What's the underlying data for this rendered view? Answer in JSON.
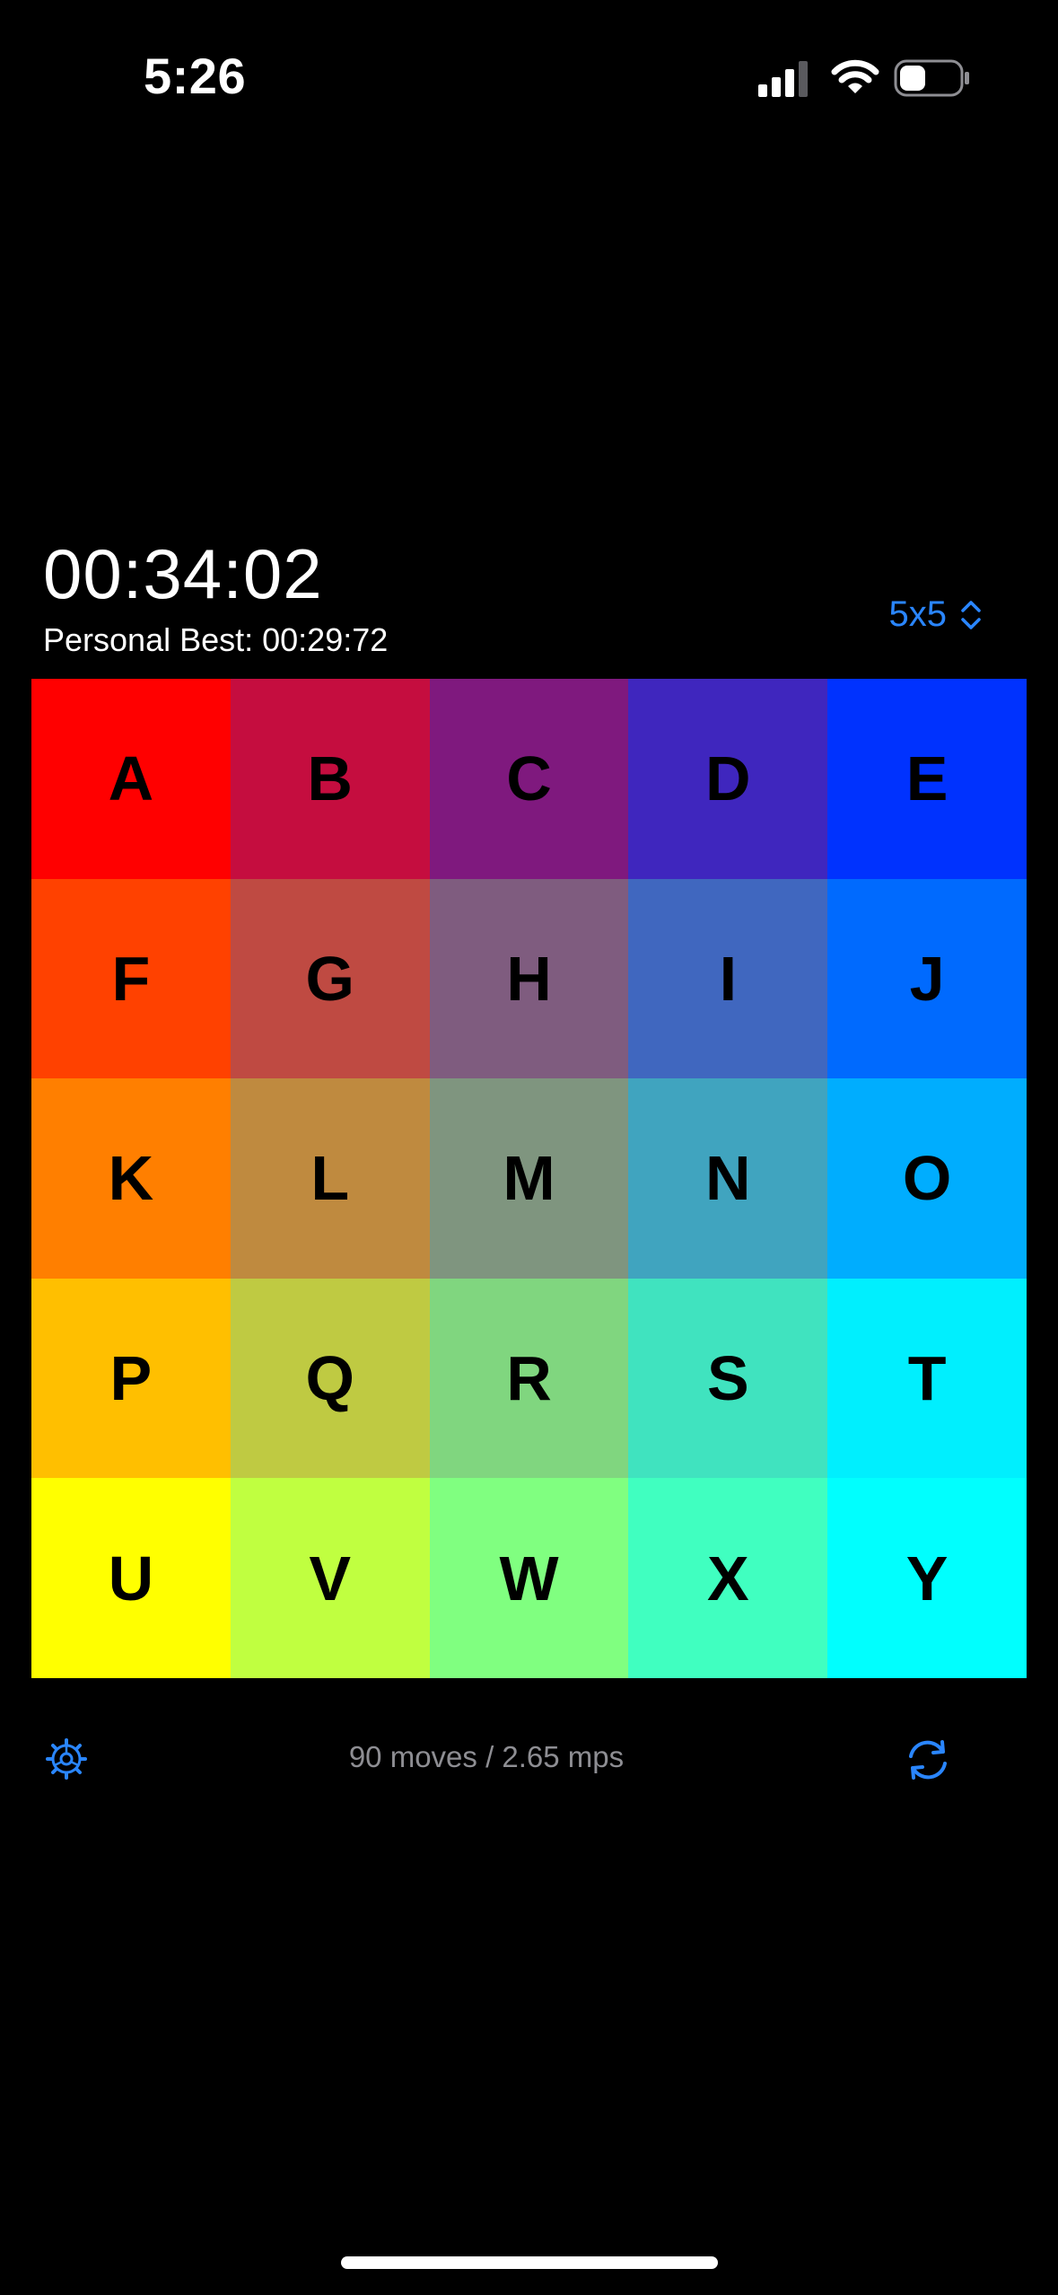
{
  "status_bar": {
    "time": "5:26",
    "signal_icon": "cellular-signal-icon",
    "wifi_icon": "wifi-icon",
    "battery_icon": "battery-icon"
  },
  "timer": {
    "elapsed": "00:34:02",
    "personal_best": "Personal Best: 00:29:72"
  },
  "size_picker": {
    "label": "5x5",
    "icon": "chevron-up-down-icon",
    "color": "#2a86ff"
  },
  "board": {
    "rows": 5,
    "cols": 5,
    "tiles": [
      {
        "label": "A",
        "color": "#ff0000"
      },
      {
        "label": "B",
        "color": "#c50d3f"
      },
      {
        "label": "C",
        "color": "#7f197e"
      },
      {
        "label": "D",
        "color": "#3f26be"
      },
      {
        "label": "E",
        "color": "#0032fe"
      },
      {
        "label": "F",
        "color": "#ff4100"
      },
      {
        "label": "G",
        "color": "#bf4a42"
      },
      {
        "label": "H",
        "color": "#7f5c7f"
      },
      {
        "label": "I",
        "color": "#4067bf"
      },
      {
        "label": "J",
        "color": "#006afe"
      },
      {
        "label": "K",
        "color": "#ff7f00"
      },
      {
        "label": "L",
        "color": "#bf8a3f"
      },
      {
        "label": "M",
        "color": "#7f957f"
      },
      {
        "label": "N",
        "color": "#40a4bf"
      },
      {
        "label": "O",
        "color": "#00adfe"
      },
      {
        "label": "P",
        "color": "#ffbf00"
      },
      {
        "label": "Q",
        "color": "#bfca42"
      },
      {
        "label": "R",
        "color": "#80d67f"
      },
      {
        "label": "S",
        "color": "#40e3bf"
      },
      {
        "label": "T",
        "color": "#00effe"
      },
      {
        "label": "U",
        "color": "#ffff00"
      },
      {
        "label": "V",
        "color": "#c0ff40"
      },
      {
        "label": "W",
        "color": "#80ff80"
      },
      {
        "label": "X",
        "color": "#40ffc0"
      },
      {
        "label": "Y",
        "color": "#00fffe"
      }
    ]
  },
  "footer": {
    "settings_icon": "gear-icon",
    "stats": "90 moves / 2.65 mps",
    "reset_icon": "refresh-icon",
    "accent_color": "#2a86ff"
  }
}
